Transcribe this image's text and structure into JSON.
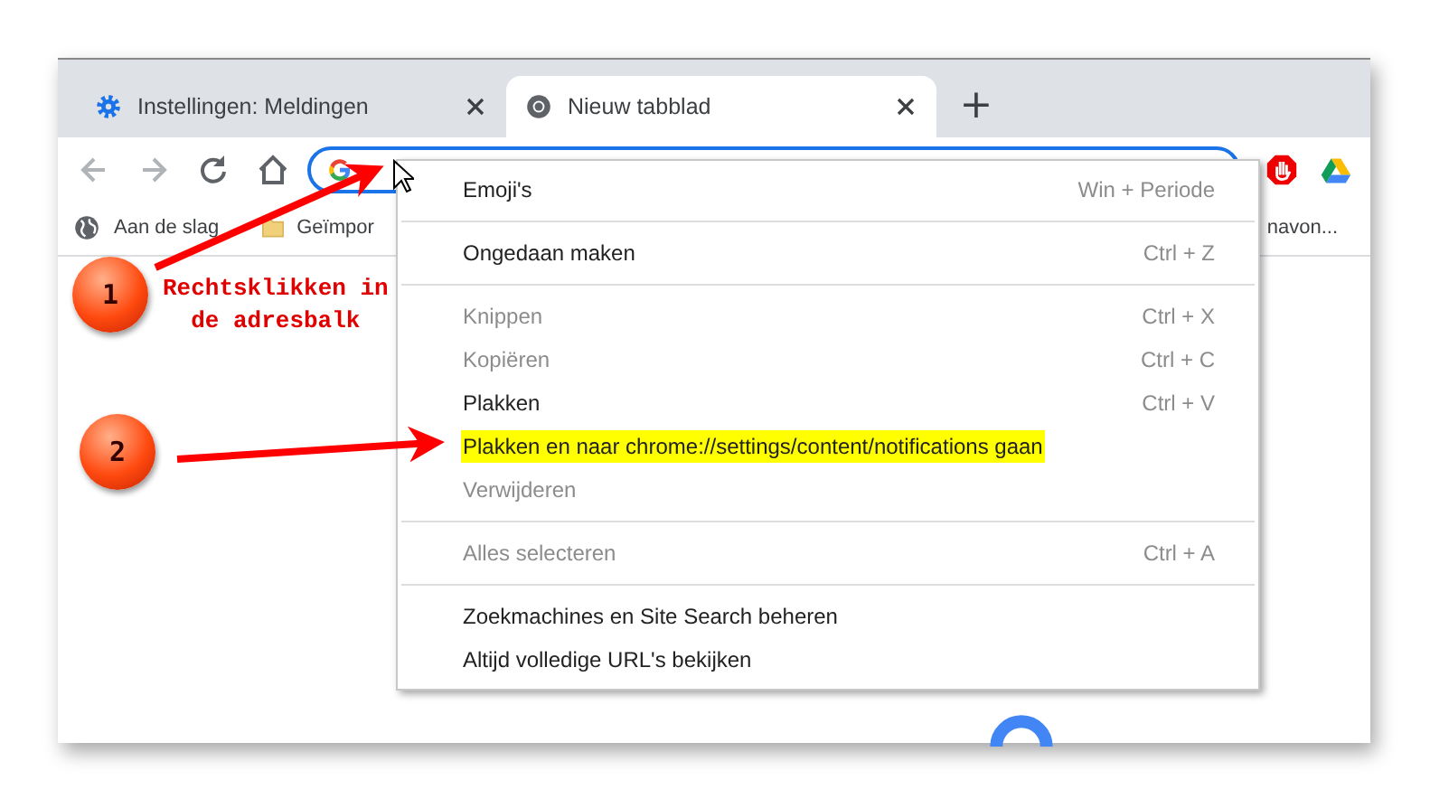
{
  "tabs": [
    {
      "label": "Instellingen: Meldingen",
      "selected": false
    },
    {
      "label": "Nieuw tabblad",
      "selected": true
    }
  ],
  "new_tab": "+",
  "bookmarks": [
    {
      "label": "Aan de slag"
    },
    {
      "label": "Geïmpor"
    },
    {
      "label": "navon..."
    }
  ],
  "context_menu": {
    "items": [
      {
        "kind": "item",
        "label": "Emoji's",
        "shortcut": "Win + Periode",
        "disabled": false,
        "highlighted": false
      },
      {
        "kind": "separator"
      },
      {
        "kind": "item",
        "label": "Ongedaan maken",
        "shortcut": "Ctrl + Z",
        "disabled": false,
        "highlighted": false
      },
      {
        "kind": "separator"
      },
      {
        "kind": "item",
        "label": "Knippen",
        "shortcut": "Ctrl + X",
        "disabled": true,
        "highlighted": false
      },
      {
        "kind": "item",
        "label": "Kopiëren",
        "shortcut": "Ctrl + C",
        "disabled": true,
        "highlighted": false
      },
      {
        "kind": "item",
        "label": "Plakken",
        "shortcut": "Ctrl + V",
        "disabled": false,
        "highlighted": false
      },
      {
        "kind": "item",
        "label": "Plakken en naar chrome://settings/content/notifications gaan",
        "disabled": false,
        "highlighted": true
      },
      {
        "kind": "item",
        "label": "Verwijderen",
        "disabled": true,
        "highlighted": false
      },
      {
        "kind": "separator"
      },
      {
        "kind": "item",
        "label": "Alles selecteren",
        "shortcut": "Ctrl + A",
        "disabled": true,
        "highlighted": false
      },
      {
        "kind": "separator"
      },
      {
        "kind": "item",
        "label": "Zoekmachines en Site Search beheren",
        "disabled": false,
        "highlighted": false
      },
      {
        "kind": "item",
        "label": "Altijd volledige URL's bekijken",
        "disabled": false,
        "highlighted": false
      }
    ]
  },
  "annotations": [
    {
      "number": "1",
      "text": "Rechtsklikken in de adresbalk"
    },
    {
      "number": "2"
    }
  ]
}
